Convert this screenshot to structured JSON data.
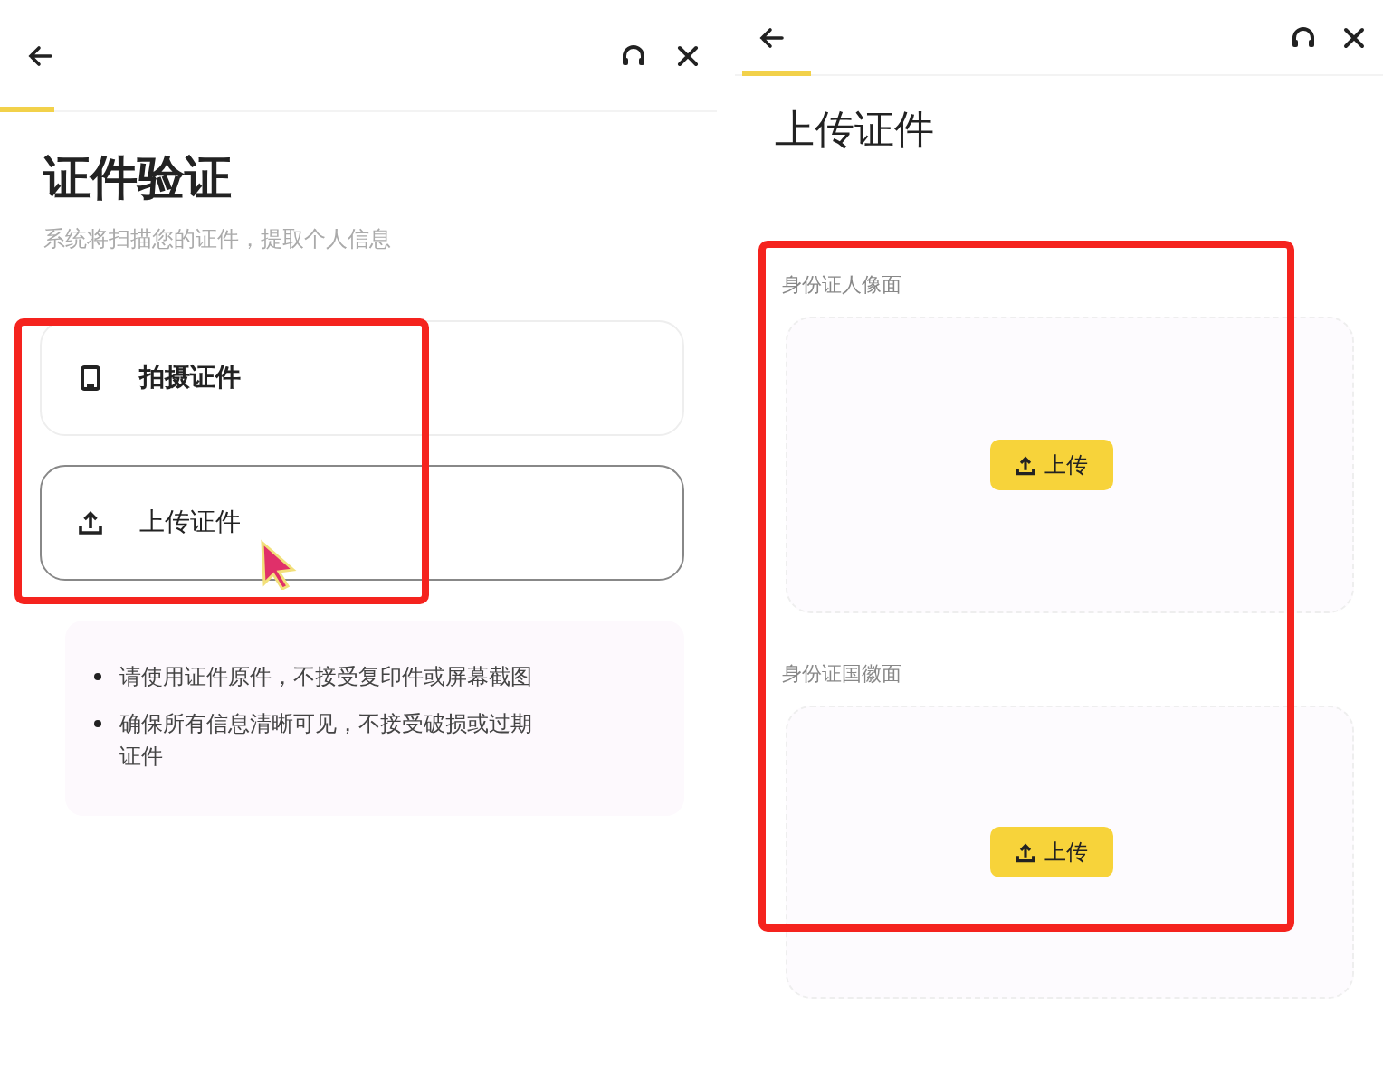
{
  "screens": [
    {
      "kind": "choose",
      "title": "证件验证",
      "subtitle": "系统将扫描您的证件，提取个人信息",
      "highlighted": true,
      "options": [
        {
          "kind": "camera",
          "label": "拍摄证件",
          "selected": false,
          "pointer": false
        },
        {
          "kind": "upload",
          "label": "上传证件",
          "selected": true,
          "pointer": true
        }
      ],
      "tips": [
        "请使用证件原件，不接受复印件或屏幕截图",
        "确保所有信息清晰可见，不接受破损或过期证件"
      ]
    },
    {
      "kind": "upload",
      "title": "上传证件",
      "highlighted": true,
      "slots": [
        {
          "label": "身份证人像面",
          "button": "上传"
        },
        {
          "label": "身份证国徽面",
          "button": "上传"
        }
      ]
    }
  ]
}
